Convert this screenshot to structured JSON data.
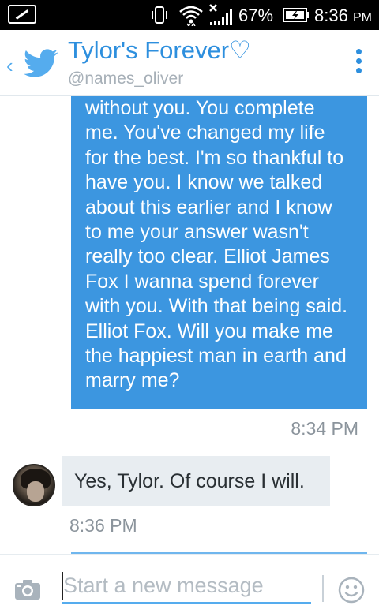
{
  "status_bar": {
    "battery_percent": "67%",
    "time": "8:36",
    "ampm": "PM"
  },
  "header": {
    "back_label": "‹",
    "title": "Tylor's Forever♡",
    "handle": "@names_oliver",
    "accent_color": "#2d8fde"
  },
  "messages": [
    {
      "direction": "outgoing",
      "text": "without you. You complete me. You've changed my life for the best. I'm so thankful to have you. I know we talked about this earlier and I know to me your answer wasn't really too clear. Elliot James Fox I wanna spend forever with you. With that being said. Elliot Fox. Will you make me the happiest man in earth and marry me?",
      "time": "8:34 PM",
      "bubble_color": "#3c96e0"
    },
    {
      "direction": "incoming",
      "text": "Yes, Tylor. Of course I will.",
      "time": "8:36 PM",
      "bubble_color": "#e8edf1"
    }
  ],
  "compose": {
    "placeholder": "Start a new message",
    "value": "",
    "camera_icon": "camera-icon",
    "emoji_icon": "emoji-icon"
  }
}
